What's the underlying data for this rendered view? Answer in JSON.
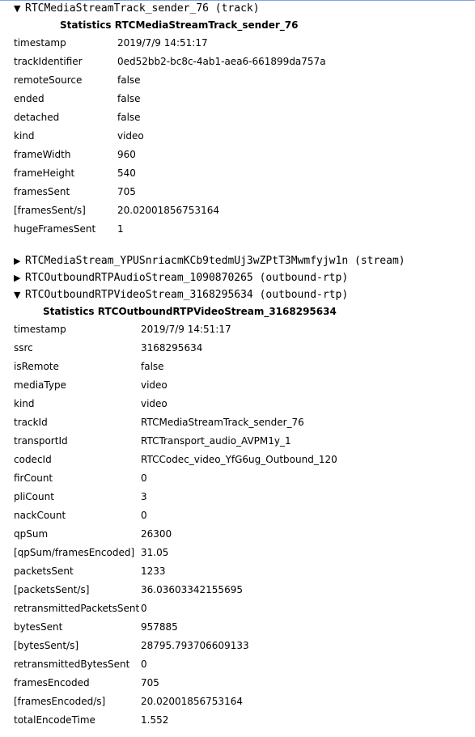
{
  "sections": [
    {
      "expanded": true,
      "header": "RTCMediaStreamTrack_sender_76 (track)",
      "stats_title": "Statistics RTCMediaStreamTrack_sender_76",
      "rows": [
        {
          "key": "timestamp",
          "value": "2019/7/9 14:51:17"
        },
        {
          "key": "trackIdentifier",
          "value": "0ed52bb2-bc8c-4ab1-aea6-661899da757a"
        },
        {
          "key": "remoteSource",
          "value": "false"
        },
        {
          "key": "ended",
          "value": "false"
        },
        {
          "key": "detached",
          "value": "false"
        },
        {
          "key": "kind",
          "value": "video"
        },
        {
          "key": "frameWidth",
          "value": "960"
        },
        {
          "key": "frameHeight",
          "value": "540"
        },
        {
          "key": "framesSent",
          "value": "705"
        },
        {
          "key": "[framesSent/s]",
          "value": "20.02001856753164"
        },
        {
          "key": "hugeFramesSent",
          "value": "1"
        }
      ]
    },
    {
      "expanded": false,
      "header": "RTCMediaStream_YPUSnriacmKCb9tedmUj3wZPtT3Mwmfyjw1n (stream)"
    },
    {
      "expanded": false,
      "header": "RTCOutboundRTPAudioStream_1090870265 (outbound-rtp)"
    },
    {
      "expanded": true,
      "header": "RTCOutboundRTPVideoStream_3168295634 (outbound-rtp)",
      "stats_title": "Statistics RTCOutboundRTPVideoStream_3168295634",
      "rows": [
        {
          "key": "timestamp",
          "value": "2019/7/9 14:51:17"
        },
        {
          "key": "ssrc",
          "value": "3168295634"
        },
        {
          "key": "isRemote",
          "value": "false"
        },
        {
          "key": "mediaType",
          "value": "video"
        },
        {
          "key": "kind",
          "value": "video"
        },
        {
          "key": "trackId",
          "value": "RTCMediaStreamTrack_sender_76"
        },
        {
          "key": "transportId",
          "value": "RTCTransport_audio_AVPM1y_1"
        },
        {
          "key": "codecId",
          "value": "RTCCodec_video_YfG6ug_Outbound_120"
        },
        {
          "key": "firCount",
          "value": "0"
        },
        {
          "key": "pliCount",
          "value": "3"
        },
        {
          "key": "nackCount",
          "value": "0"
        },
        {
          "key": "qpSum",
          "value": "26300"
        },
        {
          "key": "[qpSum/framesEncoded]",
          "value": "31.05"
        },
        {
          "key": "packetsSent",
          "value": "1233"
        },
        {
          "key": "[packetsSent/s]",
          "value": "36.03603342155695"
        },
        {
          "key": "retransmittedPacketsSent",
          "value": "0"
        },
        {
          "key": "bytesSent",
          "value": "957885"
        },
        {
          "key": "[bytesSent/s]",
          "value": "28795.793706609133"
        },
        {
          "key": "retransmittedBytesSent",
          "value": "0"
        },
        {
          "key": "framesEncoded",
          "value": "705"
        },
        {
          "key": "[framesEncoded/s]",
          "value": "20.02001856753164"
        },
        {
          "key": "totalEncodeTime",
          "value": "1.552"
        }
      ]
    }
  ],
  "icons": {
    "expanded": "triangle-down",
    "collapsed": "triangle-right"
  },
  "glyphs": {
    "expanded": "▼",
    "collapsed": "▶"
  }
}
